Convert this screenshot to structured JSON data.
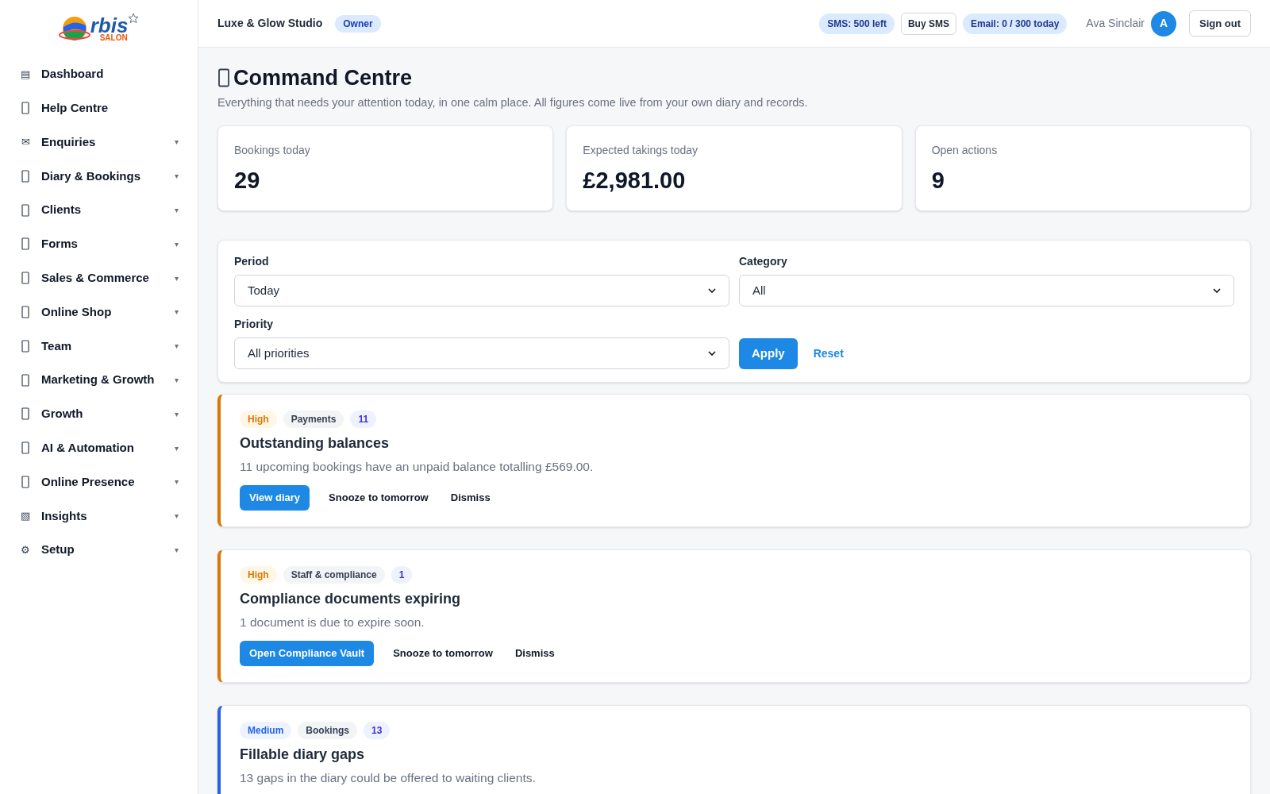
{
  "sidebar": {
    "logo": {
      "word": "rbis",
      "sub": "SALON"
    },
    "items": [
      {
        "label": "Dashboard",
        "icon": "▤"
      },
      {
        "label": "Help Centre"
      },
      {
        "label": "Enquiries",
        "icon": "✉",
        "caret": "▾"
      },
      {
        "label": "Diary & Bookings",
        "caret": "▾"
      },
      {
        "label": "Clients",
        "caret": "▾"
      },
      {
        "label": "Forms",
        "caret": "▾"
      },
      {
        "label": "Sales & Commerce",
        "caret": "▾"
      },
      {
        "label": "Online Shop",
        "caret": "▾"
      },
      {
        "label": "Team",
        "caret": "▾"
      },
      {
        "label": "Marketing & Growth",
        "caret": "▾"
      },
      {
        "label": "Growth",
        "caret": "▾"
      },
      {
        "label": "AI & Automation",
        "caret": "▾"
      },
      {
        "label": "Online Presence",
        "caret": "▾"
      },
      {
        "label": "Insights",
        "icon": "▧",
        "caret": "▾"
      },
      {
        "label": "Setup",
        "icon": "⚙",
        "caret": "▾"
      }
    ]
  },
  "header": {
    "business": "Luxe & Glow Studio",
    "role": "Owner",
    "sms": "SMS: 500 left",
    "buy_sms": "Buy SMS",
    "email": "Email: 0 / 300 today",
    "user": "Ava Sinclair",
    "avatar": "A",
    "sign_out": "Sign out"
  },
  "page": {
    "title": "Command Centre",
    "subtitle": "Everything that needs your attention today, in one calm place. All figures come live from your own diary and records."
  },
  "stats": [
    {
      "label": "Bookings today",
      "value": "29"
    },
    {
      "label": "Expected takings today",
      "value": "£2,981.00"
    },
    {
      "label": "Open actions",
      "value": "9"
    }
  ],
  "filters": {
    "period": {
      "label": "Period",
      "value": "Today"
    },
    "category": {
      "label": "Category",
      "value": "All"
    },
    "priority": {
      "label": "Priority",
      "value": "All priorities"
    },
    "apply": "Apply",
    "reset": "Reset"
  },
  "alerts": [
    {
      "priority": "High",
      "kind": "high",
      "category": "Payments",
      "count": "11",
      "title": "Outstanding balances",
      "text": "11 upcoming bookings have an unpaid balance totalling £569.00.",
      "actions": [
        "View diary",
        "Snooze to tomorrow",
        "Dismiss"
      ]
    },
    {
      "priority": "High",
      "kind": "high",
      "category": "Staff & compliance",
      "count": "1",
      "title": "Compliance documents expiring",
      "text": "1 document is due to expire soon.",
      "actions": [
        "Open Compliance Vault",
        "Snooze to tomorrow",
        "Dismiss"
      ]
    },
    {
      "priority": "Medium",
      "kind": "medium",
      "category": "Bookings",
      "count": "13",
      "title": "Fillable diary gaps",
      "text": "13 gaps in the diary could be offered to waiting clients."
    }
  ]
}
